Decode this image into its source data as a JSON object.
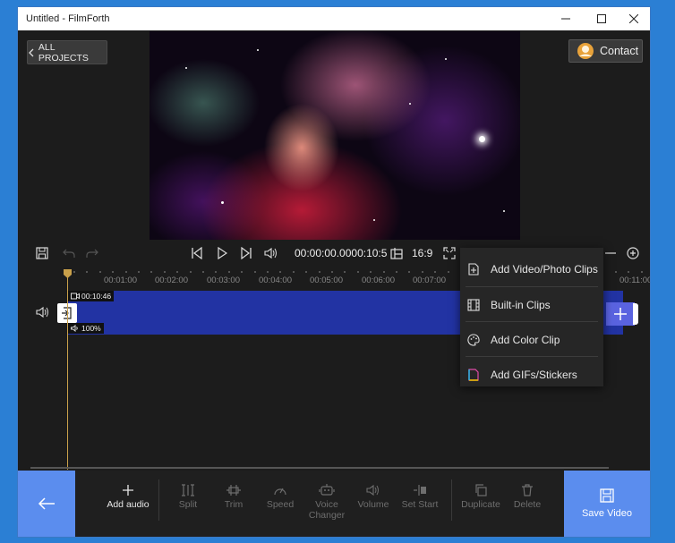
{
  "window": {
    "title": "Untitled - FilmForth"
  },
  "header": {
    "all_projects_label": "ALL PROJECTS",
    "contact_label": "Contact"
  },
  "player": {
    "timecode": "00:00:00.0000:10:5",
    "aspect_ratio": "16:9"
  },
  "timeline": {
    "ticks": [
      "00:01:00",
      "00:02:00",
      "00:03:00",
      "00:04:00",
      "00:05:00",
      "00:06:00",
      "00:07:00"
    ],
    "end_tick": "00:11:00",
    "clip_duration": "00:10:46",
    "clip_volume": "100%"
  },
  "add_menu": {
    "items": [
      {
        "label": "Add Video/Photo Clips",
        "icon": "add-file-icon"
      },
      {
        "label": "Built-in Clips",
        "icon": "film-strip-icon"
      },
      {
        "label": "Add Color Clip",
        "icon": "palette-icon"
      },
      {
        "label": "Add GIFs/Stickers",
        "icon": "sticker-file-icon"
      }
    ]
  },
  "bottom": {
    "add_audio": "Add audio",
    "tools": [
      {
        "label": "Split",
        "icon": "split-icon"
      },
      {
        "label": "Trim",
        "icon": "trim-icon"
      },
      {
        "label": "Speed",
        "icon": "speedometer-icon"
      },
      {
        "label": "Voice Changer",
        "icon": "robot-icon"
      },
      {
        "label": "Volume",
        "icon": "speaker-icon"
      },
      {
        "label": "Set Start",
        "icon": "set-start-icon"
      },
      {
        "label": "Duplicate",
        "icon": "duplicate-icon"
      },
      {
        "label": "Delete",
        "icon": "trash-icon"
      }
    ],
    "save_label": "Save Video"
  },
  "colors": {
    "accent": "#5b8dee",
    "track": "#2233a3",
    "playhead": "#c9a04a"
  }
}
